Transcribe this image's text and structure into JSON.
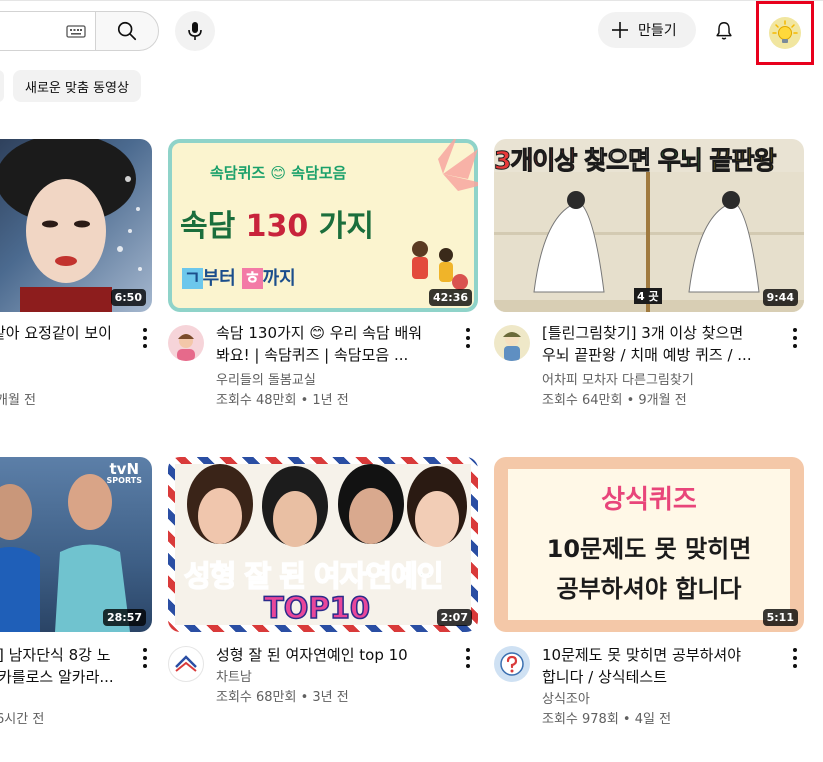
{
  "header": {
    "search_placeholder": "",
    "create_label": "만들기"
  },
  "chips": {
    "new_recommended": "새로운 맞춤 동영상"
  },
  "videos": [
    {
      "title_line1": "같아 요정같이 보이",
      "title_line2": "",
      "channel": "",
      "meta": "개월 전",
      "duration": "6:50"
    },
    {
      "title_line1": "속담 130가지 😊 우리 속담 배워",
      "title_line2": "봐요! | 속담퀴즈 | 속담모음 ...",
      "channel": "우리들의 돌봄교실",
      "meta": "조회수 48만회 • 1년 전",
      "duration": "42:36",
      "thumb_top": "속담퀴즈 😊 속담모음",
      "thumb_main_a": "속담 ",
      "thumb_main_b": "130",
      "thumb_main_c": " 가지",
      "thumb_from": "ㄱ",
      "thumb_mid": "부터 ",
      "thumb_to": "ㅎ",
      "thumb_end": "까지"
    },
    {
      "title_line1": "[틀린그림찾기] 3개 이상 찾으면",
      "title_line2": "우뇌 끝판왕 / 치매 예방 퀴즈 / ...",
      "channel": "어차피 모차자 다른그림찾기",
      "meta": "조회수 64만회 • 9개월 전",
      "duration": "9:44",
      "thumb_a": "3개이상 ",
      "thumb_b": "찾으면 ",
      "thumb_c": "우뇌 ",
      "thumb_d": "끝판왕",
      "thumb_counter": "4 곳"
    },
    {
      "title_line1": "] 남자단식 8강 노",
      "title_line2": "카를로스 알카라...",
      "channel": "",
      "meta": "6시간 전",
      "duration": "28:57",
      "thumb_logo_a": "tvN",
      "thumb_logo_b": "SPORTS"
    },
    {
      "title_line1": "성형 잘 된 여자연예인 top 10",
      "title_line2": "",
      "channel": "차트남",
      "meta": "조회수 68만회 • 3년 전",
      "duration": "2:07",
      "thumb_a": "성형 잘 된 ",
      "thumb_b": "여자",
      "thumb_c": "연예인",
      "thumb_d": "TOP10"
    },
    {
      "title_line1": "10문제도 못 맞히면 공부하셔야",
      "title_line2": "합니다 / 상식테스트",
      "channel": "상식조아",
      "meta": "조회수 978회 • 4일 전",
      "duration": "5:11",
      "thumb_a": "상식퀴즈",
      "thumb_b": "10문제도 못 맞히면",
      "thumb_c": "공부하셔야 합니다"
    }
  ],
  "colors": {
    "accent_red": "#e8001c",
    "thumb_teal": "#8fd3c9",
    "thumb_peach": "#f4c8a8",
    "quiz_pink": "#e8457a"
  }
}
